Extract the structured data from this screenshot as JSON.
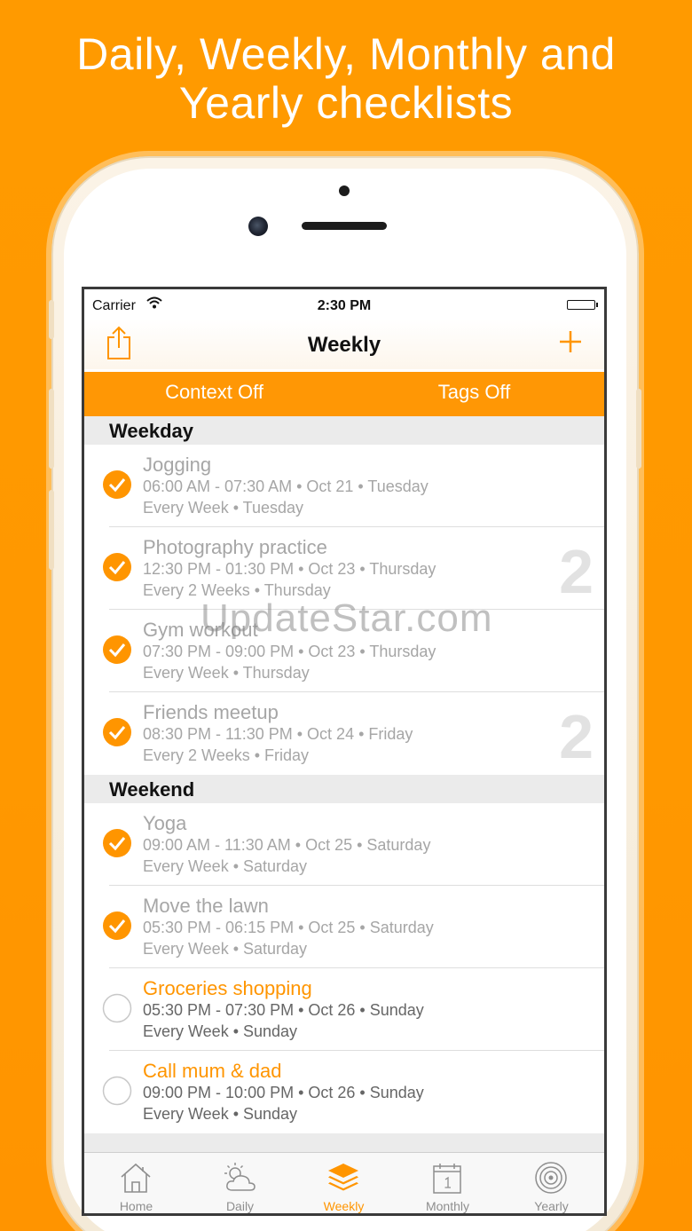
{
  "promo": {
    "headline_line1": "Daily, Weekly, Monthly and",
    "headline_line2": "Yearly checklists"
  },
  "status_bar": {
    "carrier": "Carrier",
    "time": "2:30 PM"
  },
  "nav": {
    "title": "Weekly",
    "share_icon": "share-icon",
    "add_icon": "plus-icon"
  },
  "toggles": {
    "context": "Context Off",
    "tags": "Tags Off"
  },
  "sections": [
    {
      "title": "Weekday",
      "items": [
        {
          "name": "Jogging",
          "time": "06:00 AM - 07:30 AM • Oct 21 • Tuesday",
          "repeat": "Every Week • Tuesday",
          "done": true,
          "badge": ""
        },
        {
          "name": "Photography practice",
          "time": "12:30 PM - 01:30 PM • Oct 23 • Thursday",
          "repeat": "Every 2 Weeks • Thursday",
          "done": true,
          "badge": "2"
        },
        {
          "name": "Gym workout",
          "time": "07:30 PM - 09:00 PM • Oct 23 • Thursday",
          "repeat": "Every Week • Thursday",
          "done": true,
          "badge": ""
        },
        {
          "name": "Friends meetup",
          "time": "08:30 PM - 11:30 PM • Oct 24 • Friday",
          "repeat": "Every 2 Weeks • Friday",
          "done": true,
          "badge": "2"
        }
      ]
    },
    {
      "title": "Weekend",
      "items": [
        {
          "name": "Yoga",
          "time": "09:00 AM - 11:30 AM • Oct 25 • Saturday",
          "repeat": "Every Week • Saturday",
          "done": true,
          "badge": ""
        },
        {
          "name": "Move the lawn",
          "time": "05:30 PM - 06:15 PM • Oct 25 • Saturday",
          "repeat": "Every Week • Saturday",
          "done": true,
          "badge": ""
        },
        {
          "name": "Groceries shopping",
          "time": "05:30 PM - 07:30 PM • Oct 26 • Sunday",
          "repeat": "Every Week • Sunday",
          "done": false,
          "badge": ""
        },
        {
          "name": "Call mum & dad",
          "time": "09:00 PM - 10:00 PM • Oct 26 • Sunday",
          "repeat": "Every Week • Sunday",
          "done": false,
          "badge": ""
        }
      ]
    }
  ],
  "tabs": [
    {
      "label": "Home",
      "icon": "home-icon",
      "active": false
    },
    {
      "label": "Daily",
      "icon": "weather-icon",
      "active": false
    },
    {
      "label": "Weekly",
      "icon": "layers-icon",
      "active": true
    },
    {
      "label": "Monthly",
      "icon": "calendar-icon",
      "active": false
    },
    {
      "label": "Yearly",
      "icon": "target-icon",
      "active": false
    }
  ],
  "watermark": "UpdateStar.com",
  "colors": {
    "accent": "#ff9500",
    "background": "#ff9a00",
    "done_text": "#a6a6a6"
  }
}
